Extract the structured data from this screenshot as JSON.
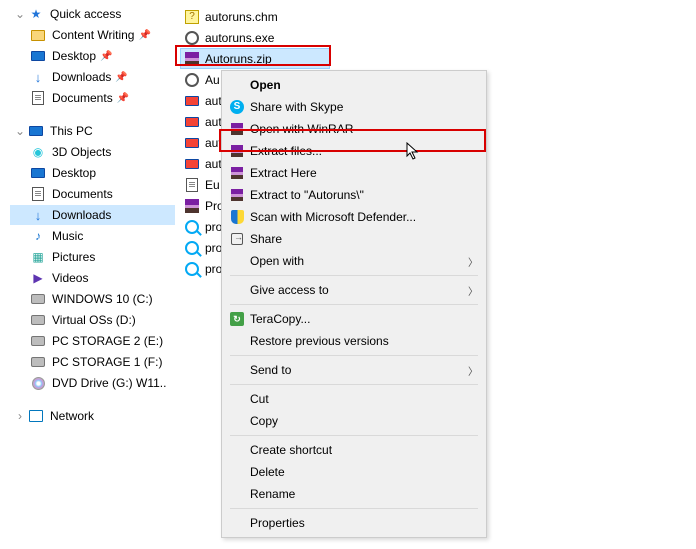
{
  "nav": {
    "quick_access": "Quick access",
    "content_writing": "Content Writing",
    "desktop": "Desktop",
    "downloads": "Downloads",
    "documents": "Documents",
    "this_pc": "This PC",
    "objects_3d": "3D Objects",
    "music": "Music",
    "pictures": "Pictures",
    "videos": "Videos",
    "win10": "WINDOWS 10 (C:)",
    "vos": "Virtual OSs (D:)",
    "pcs2": "PC STORAGE 2 (E:)",
    "pcs1": "PC STORAGE 1 (F:)",
    "dvd": "DVD Drive (G:) W11..",
    "network": "Network",
    "pin": "📌"
  },
  "files": {
    "f0": "autoruns.chm",
    "f1": "autoruns.exe",
    "f2": "Autoruns.zip",
    "au_trunc": "Au",
    "au2_trunc": "aut",
    "eu_trunc": "Eu",
    "pro_trunc": "Pro",
    "pro2_trunc": "pro",
    "pro3_trunc": "pro"
  },
  "ctx": {
    "open": "Open",
    "skype": "Share with Skype",
    "open_winrar": "Open with WinRAR",
    "extract_files": "Extract files...",
    "extract_here": "Extract Here",
    "extract_to": "Extract to \"Autoruns\\\"",
    "scan": "Scan with Microsoft Defender...",
    "share": "Share",
    "open_with": "Open with",
    "give_access": "Give access to",
    "teracopy": "TeraCopy...",
    "restore": "Restore previous versions",
    "send_to": "Send to",
    "cut": "Cut",
    "copy": "Copy",
    "shortcut": "Create shortcut",
    "delete": "Delete",
    "rename": "Rename",
    "properties": "Properties"
  }
}
